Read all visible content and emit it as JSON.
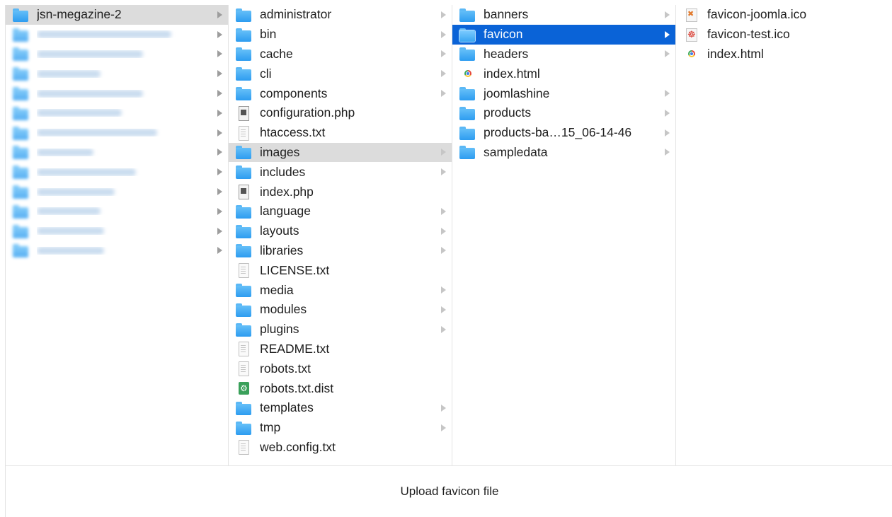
{
  "columns": {
    "root": {
      "selected": "jsn-megazine-2",
      "blurred_rows": 12
    },
    "site": [
      {
        "label": "administrator",
        "icon": "folder-icon",
        "arrow": true
      },
      {
        "label": "bin",
        "icon": "folder-icon",
        "arrow": true
      },
      {
        "label": "cache",
        "icon": "folder-icon",
        "arrow": true
      },
      {
        "label": "cli",
        "icon": "folder-icon",
        "arrow": true
      },
      {
        "label": "components",
        "icon": "folder-icon",
        "arrow": true
      },
      {
        "label": "configuration.php",
        "icon": "php-file-icon",
        "arrow": false
      },
      {
        "label": "htaccess.txt",
        "icon": "text-file-icon",
        "arrow": false
      },
      {
        "label": "images",
        "icon": "folder-icon",
        "arrow": true
      },
      {
        "label": "includes",
        "icon": "folder-icon",
        "arrow": true
      },
      {
        "label": "index.php",
        "icon": "php-file-icon",
        "arrow": false
      },
      {
        "label": "language",
        "icon": "folder-icon",
        "arrow": true
      },
      {
        "label": "layouts",
        "icon": "folder-icon",
        "arrow": true
      },
      {
        "label": "libraries",
        "icon": "folder-icon",
        "arrow": true
      },
      {
        "label": "LICENSE.txt",
        "icon": "text-file-icon",
        "arrow": false
      },
      {
        "label": "media",
        "icon": "folder-icon",
        "arrow": true
      },
      {
        "label": "modules",
        "icon": "folder-icon",
        "arrow": true
      },
      {
        "label": "plugins",
        "icon": "folder-icon",
        "arrow": true
      },
      {
        "label": "README.txt",
        "icon": "text-file-icon",
        "arrow": false
      },
      {
        "label": "robots.txt",
        "icon": "text-file-icon",
        "arrow": false
      },
      {
        "label": "robots.txt.dist",
        "icon": "dist-file-icon",
        "arrow": false
      },
      {
        "label": "templates",
        "icon": "folder-icon",
        "arrow": true
      },
      {
        "label": "tmp",
        "icon": "folder-icon",
        "arrow": true
      },
      {
        "label": "web.config.txt",
        "icon": "text-file-icon",
        "arrow": false
      }
    ],
    "site_selected": "images",
    "images": [
      {
        "label": "banners",
        "icon": "folder-icon",
        "arrow": true
      },
      {
        "label": "favicon",
        "icon": "folder-icon",
        "arrow": true
      },
      {
        "label": "headers",
        "icon": "folder-icon",
        "arrow": true
      },
      {
        "label": "index.html",
        "icon": "html-file-icon",
        "arrow": false
      },
      {
        "label": "joomlashine",
        "icon": "folder-icon",
        "arrow": true
      },
      {
        "label": "products",
        "icon": "folder-icon",
        "arrow": true
      },
      {
        "label": "products-ba…15_06-14-46",
        "icon": "folder-icon",
        "arrow": true
      },
      {
        "label": "sampledata",
        "icon": "folder-icon",
        "arrow": true
      }
    ],
    "images_selected": "favicon",
    "favicon": [
      {
        "label": "favicon-joomla.ico",
        "icon": "ico-file-icon",
        "arrow": false
      },
      {
        "label": "favicon-test.ico",
        "icon": "ico-file-icon",
        "arrow": false
      },
      {
        "label": "index.html",
        "icon": "html-file-icon",
        "arrow": false
      }
    ]
  },
  "caption": "Upload favicon file",
  "colors": {
    "selection_blue": "#0a63d7",
    "selection_gray": "#dcdcdc",
    "folder_blue": "#2d9cf0"
  }
}
